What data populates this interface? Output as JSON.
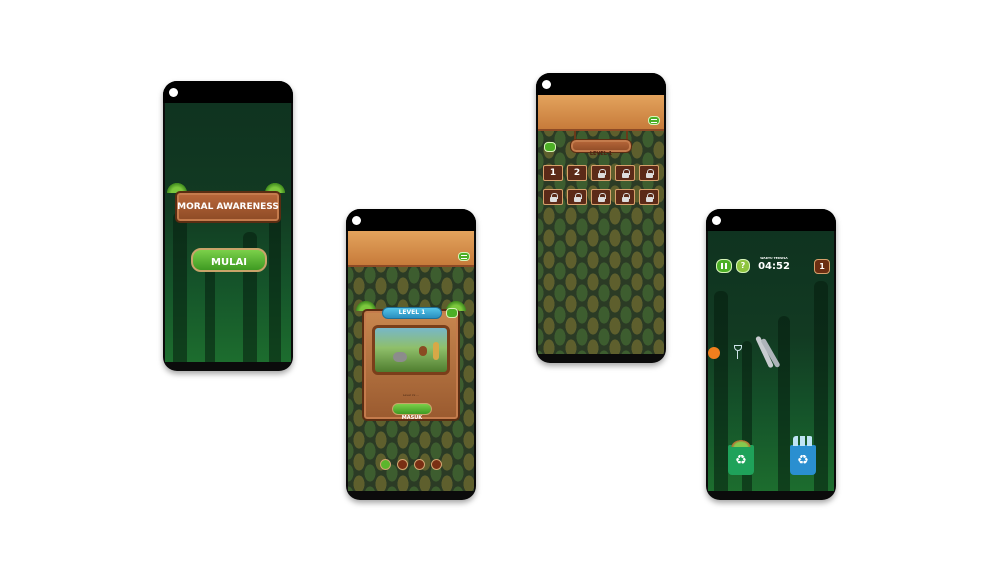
{
  "screen1": {
    "title": "MORAL AWARENESS",
    "start_button": "MULAI"
  },
  "screen2": {
    "level_label": "LEVEL 1",
    "caption": "Level ini ...",
    "enter_button": "MASUK",
    "pager_active": 1,
    "pager_total": 4
  },
  "screen3": {
    "level_label": "LEVEL 1",
    "unlocked_levels": [
      "1",
      "2"
    ],
    "locked_count": 8
  },
  "screen4": {
    "timer_label": "WAKTU TERSISA",
    "timer_value": "04:52",
    "score_value": "1",
    "pause_icon": "pause-icon",
    "help_icon": "help-icon",
    "help_symbol": "?",
    "recycle_symbol": "♻"
  },
  "colors": {
    "wood": "#a65a30",
    "button_green": "#4caf26",
    "header_orange": "#d89050",
    "forest_green": "#15542a"
  }
}
